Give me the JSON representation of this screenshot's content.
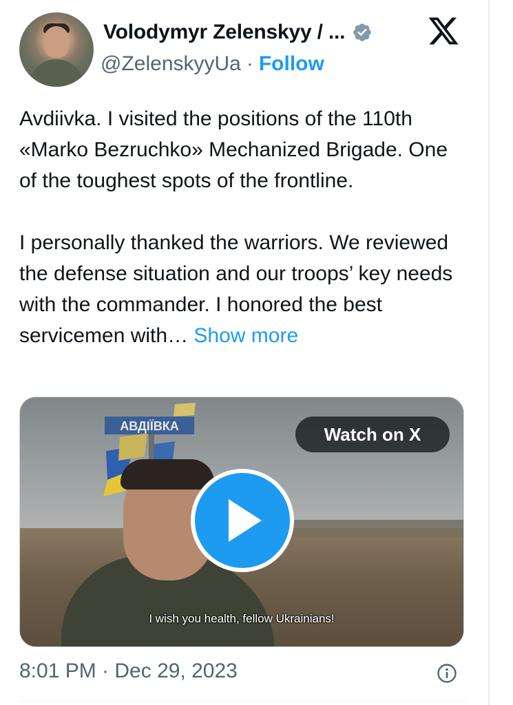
{
  "author": {
    "name": "Volodymyr Zelenskyy / ...",
    "handle": "@ZelenskyyUa",
    "separator": "·",
    "follow_label": "Follow",
    "verified": true,
    "avatar_icon": "avatar-photo"
  },
  "brand": {
    "logo_icon": "x-logo-icon"
  },
  "post": {
    "paragraph1": "Avdiivka. I visited the positions of the 110th «Marko Bezruchko» Mechanized Brigade. One of the toughest spots of the frontline.",
    "paragraph2": "I personally thanked the warriors. We reviewed the defense situation and our troops’ key needs with the commander. I honored the best servicemen with…",
    "show_more_label": "Show more"
  },
  "media": {
    "watch_label": "Watch on X",
    "caption": "I wish you health, fellow Ukrainians!",
    "play_icon": "play-icon",
    "sign_text": "АВДІЇВКА"
  },
  "meta": {
    "timestamp": "8:01 PM · Dec 29, 2023",
    "info_icon": "info-icon"
  },
  "colors": {
    "accent": "#1d9bf0",
    "secondary_text": "#536471",
    "primary_text": "#0f1419",
    "verified_badge": "#829aab"
  }
}
